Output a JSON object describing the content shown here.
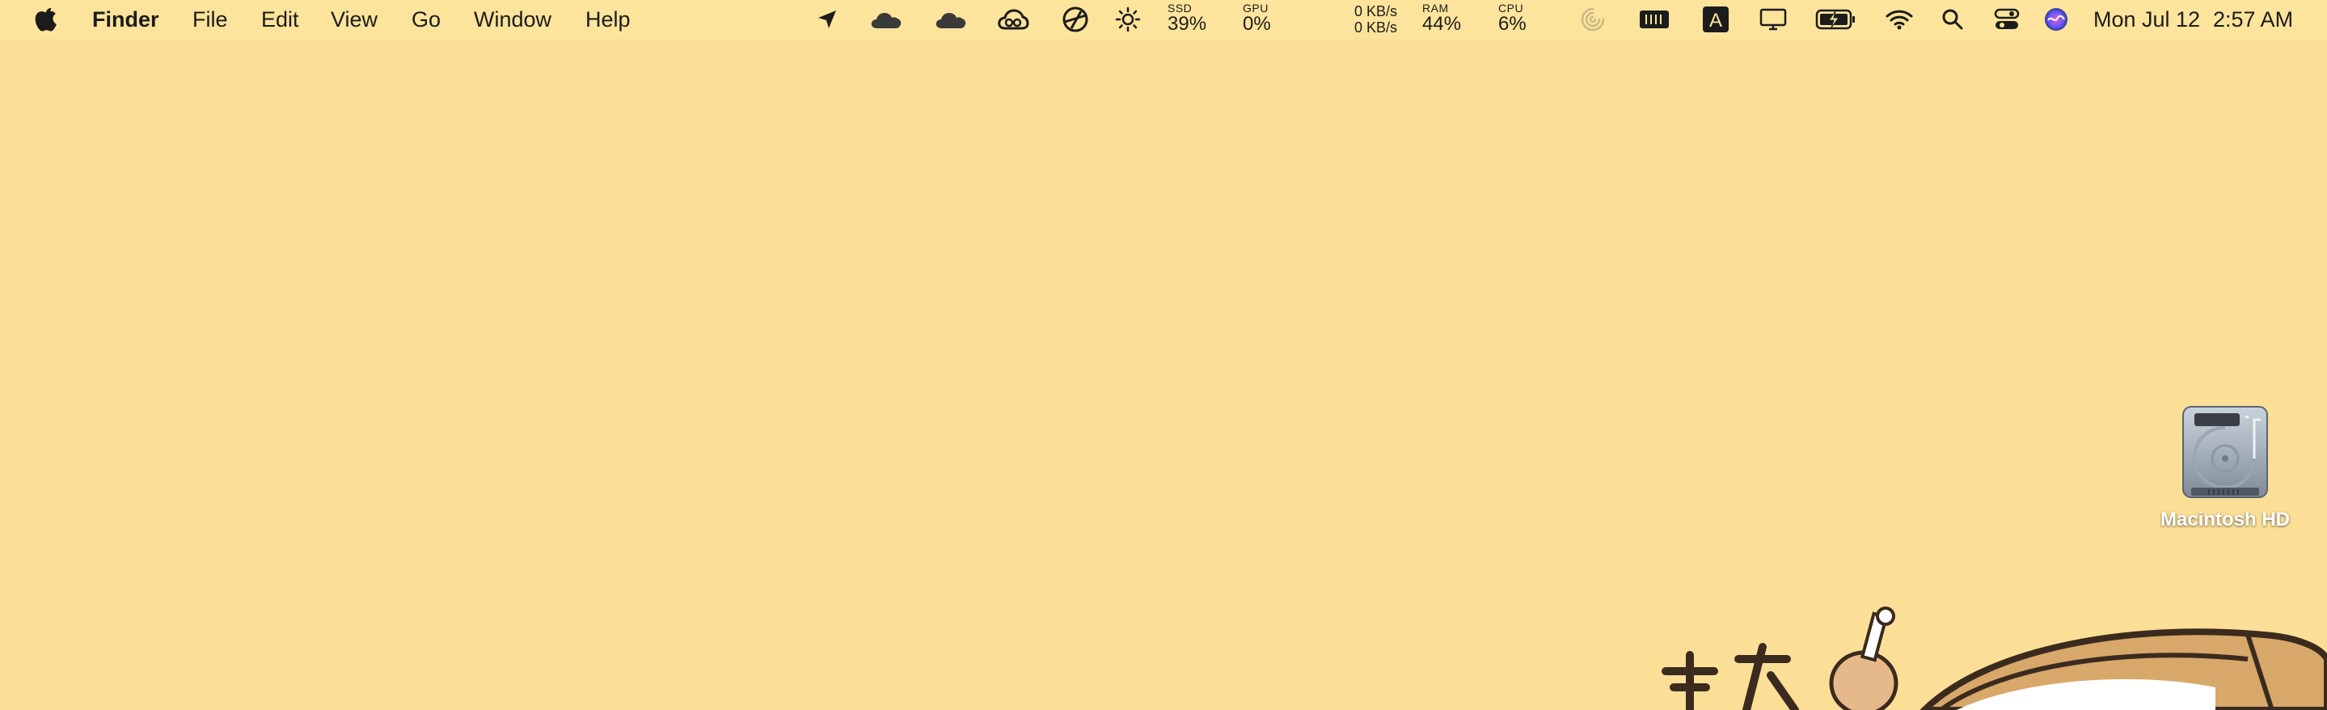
{
  "menubar": {
    "apple_icon": "apple-logo-icon",
    "app_name": "Finder",
    "menus": [
      "File",
      "Edit",
      "View",
      "Go",
      "Window",
      "Help"
    ],
    "status_icons": [
      "location-arrow-icon",
      "onedrive-cloud-icon",
      "onedrive-cloud-icon",
      "creative-cloud-icon",
      "linear-sync-icon",
      "brightness-icon"
    ],
    "ssd": {
      "label": "SSD",
      "value": "39%"
    },
    "gpu": {
      "label": "GPU",
      "value": "0%"
    },
    "network": {
      "up": "0 KB/s",
      "down": "0 KB/s"
    },
    "ram": {
      "label": "RAM",
      "value": "44%"
    },
    "cpu": {
      "label": "CPU",
      "value": "6%"
    },
    "right_icons": [
      "spinner-icon",
      "memory-icon",
      "input-source-icon",
      "display-icon",
      "battery-charging-icon",
      "wifi-icon",
      "spotlight-search-icon",
      "control-center-icon",
      "siri-icon"
    ],
    "input_source_letter": "A",
    "clock": {
      "date": "Mon Jul 12",
      "time": "2:57 AM"
    }
  },
  "desktop": {
    "icons": [
      {
        "label": "Macintosh HD",
        "icon": "hard-drive-icon"
      }
    ],
    "background_color": "#fcdf97"
  }
}
